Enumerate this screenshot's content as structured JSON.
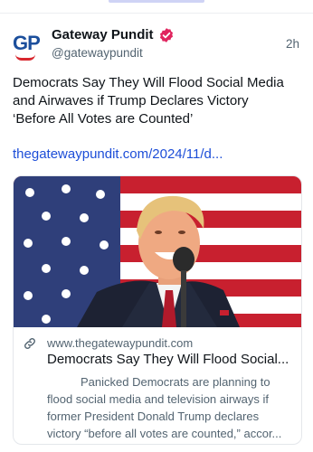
{
  "post": {
    "author_name": "Gateway Pundit",
    "author_handle": "@gatewaypundit",
    "avatar_text": "GP",
    "verified_icon": "verified-badge-icon",
    "time": "2h",
    "text_line1": "Democrats Say They Will Flood Social Media",
    "text_line2": "and Airwaves if Trump Declares Victory",
    "text_line3": "‘Before All Votes are Counted’",
    "link": "thegatewaypundit.com/2024/11/d..."
  },
  "card": {
    "link_icon": "link-icon",
    "domain": "www.thegatewaypundit.com",
    "title": "Democrats Say They Will Flood Social...",
    "description_line1": "Panicked Democrats are planning to",
    "description_line2": "flood social media and television airways if",
    "description_line3": "former President Donald Trump declares",
    "description_line4": "victory “before all votes are counted,” accor..."
  },
  "colors": {
    "brand_blue": "#1c4f9c",
    "brand_red": "#d8272e",
    "verified": "#e0245e",
    "link": "#1d4ed8",
    "muted_text": "#536471"
  }
}
